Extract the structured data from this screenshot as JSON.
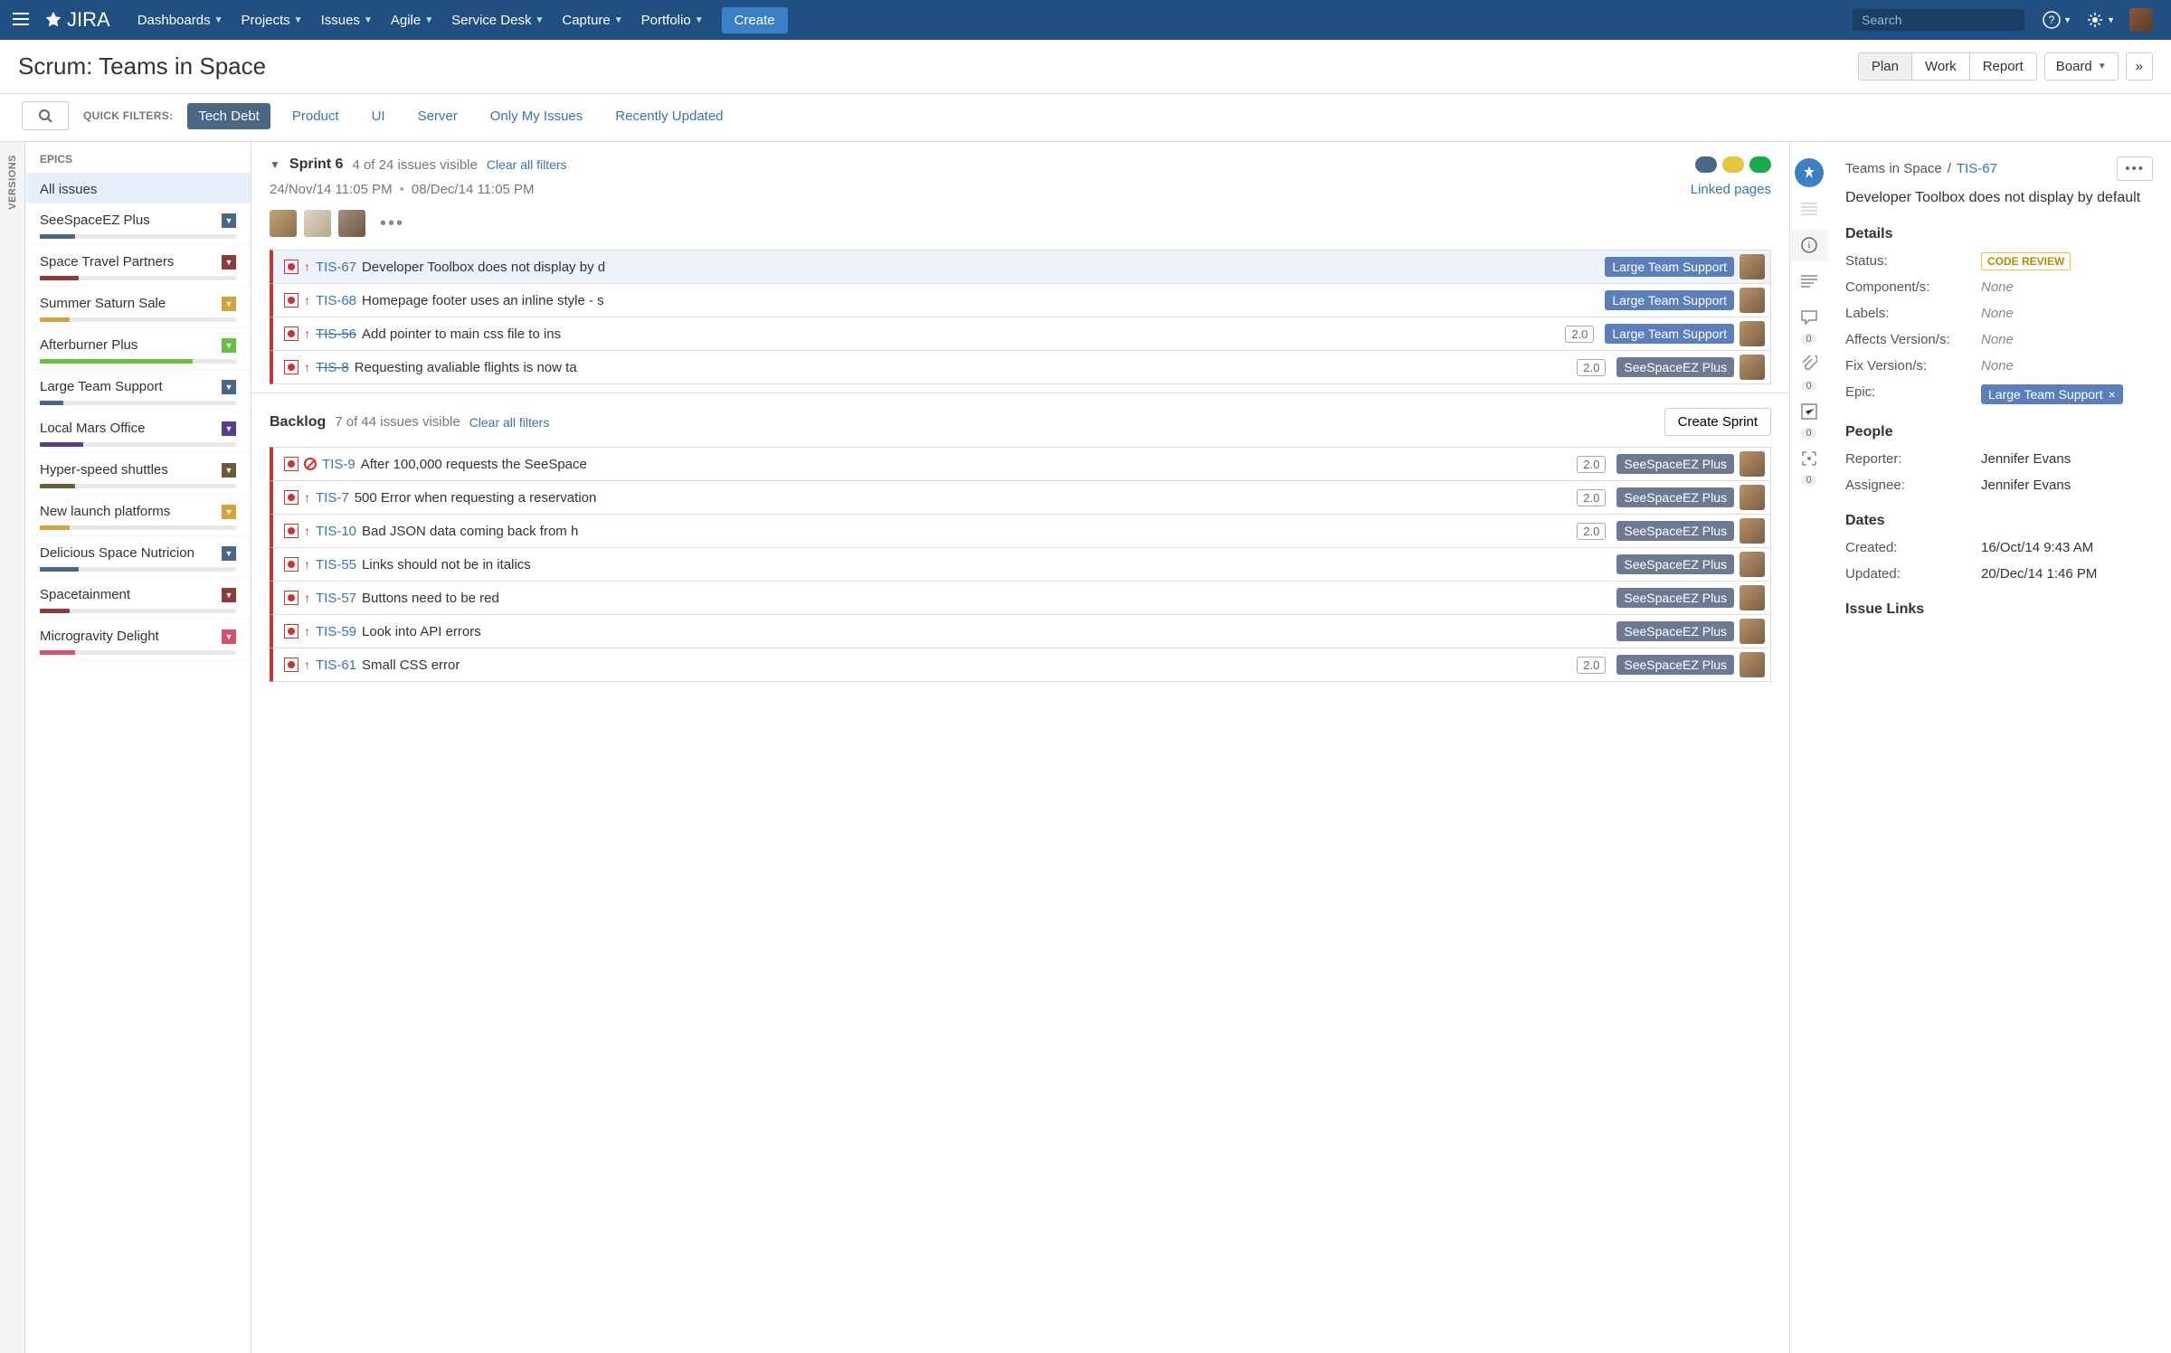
{
  "topnav": {
    "logo": "JIRA",
    "items": [
      "Dashboards",
      "Projects",
      "Issues",
      "Agile",
      "Service Desk",
      "Capture",
      "Portfolio"
    ],
    "create": "Create",
    "search_placeholder": "Search"
  },
  "header": {
    "title": "Scrum: Teams in Space",
    "views": [
      "Plan",
      "Work",
      "Report"
    ],
    "active_view": "Plan",
    "board_label": "Board"
  },
  "filters": {
    "label": "QUICK FILTERS:",
    "items": [
      "Tech Debt",
      "Product",
      "UI",
      "Server",
      "Only My Issues",
      "Recently Updated"
    ],
    "active": "Tech Debt"
  },
  "versions_label": "VERSIONS",
  "epics": {
    "header": "EPICS",
    "all_issues": "All issues",
    "items": [
      {
        "name": "SeeSpaceEZ Plus",
        "color": "#4a6785",
        "fill": 18
      },
      {
        "name": "Space Travel Partners",
        "color": "#8e3b3b",
        "fill": 20
      },
      {
        "name": "Summer Saturn Sale",
        "color": "#d6a23a",
        "fill": 15
      },
      {
        "name": "Afterburner Plus",
        "color": "#6abf40",
        "fill": 78
      },
      {
        "name": "Large Team Support",
        "color": "#4a6785",
        "fill": 12
      },
      {
        "name": "Local Mars Office",
        "color": "#5b3b8e",
        "fill": 22
      },
      {
        "name": "Hyper-speed shuttles",
        "color": "#6b5a3b",
        "fill": 18
      },
      {
        "name": "New launch platforms",
        "color": "#d6a23a",
        "fill": 15
      },
      {
        "name": "Delicious Space Nutricion",
        "color": "#4a6785",
        "fill": 20
      },
      {
        "name": "Spacetainment",
        "color": "#8e3b3b",
        "fill": 15
      },
      {
        "name": "Microgravity Delight",
        "color": "#d6506b",
        "fill": 18
      }
    ]
  },
  "sprint": {
    "name": "Sprint 6",
    "count_text": "4 of 24 issues visible",
    "clear": "Clear all filters",
    "date_start": "24/Nov/14 11:05 PM",
    "date_end": "08/Dec/14 11:05 PM",
    "linked": "Linked pages",
    "dot_colors": [
      "#4a6785",
      "#e4c641",
      "#1aab4e"
    ],
    "issues": [
      {
        "key": "TIS-67",
        "summary": "Developer Toolbox does not display by d",
        "epic": "Large Team Support",
        "epicClass": "blue",
        "selected": true
      },
      {
        "key": "TIS-68",
        "summary": "Homepage footer uses an inline style - s",
        "epic": "Large Team Support",
        "epicClass": "blue"
      },
      {
        "key": "TIS-56",
        "summary": "Add pointer to main css file to ins",
        "epic": "Large Team Support",
        "epicClass": "blue",
        "ver": "2.0",
        "strike": true
      },
      {
        "key": "TIS-8",
        "summary": "Requesting avaliable flights is now ta",
        "epic": "SeeSpaceEZ Plus",
        "epicClass": "slate",
        "ver": "2.0",
        "strike": true
      }
    ]
  },
  "backlog": {
    "name": "Backlog",
    "count_text": "7 of 44 issues visible",
    "clear": "Clear all filters",
    "create_sprint": "Create Sprint",
    "issues": [
      {
        "key": "TIS-9",
        "summary": "After 100,000 requests the SeeSpace",
        "epic": "SeeSpaceEZ Plus",
        "epicClass": "slate",
        "ver": "2.0",
        "blocker": true
      },
      {
        "key": "TIS-7",
        "summary": "500 Error when requesting a reservation",
        "epic": "SeeSpaceEZ Plus",
        "epicClass": "slate",
        "ver": "2.0"
      },
      {
        "key": "TIS-10",
        "summary": "Bad JSON data coming back from h",
        "epic": "SeeSpaceEZ Plus",
        "epicClass": "slate",
        "ver": "2.0"
      },
      {
        "key": "TIS-55",
        "summary": "Links should not be in italics",
        "epic": "SeeSpaceEZ Plus",
        "epicClass": "slate"
      },
      {
        "key": "TIS-57",
        "summary": "Buttons need to be red",
        "epic": "SeeSpaceEZ Plus",
        "epicClass": "slate"
      },
      {
        "key": "TIS-59",
        "summary": "Look into API errors",
        "epic": "SeeSpaceEZ Plus",
        "epicClass": "slate"
      },
      {
        "key": "TIS-61",
        "summary": "Small CSS error",
        "epic": "SeeSpaceEZ Plus",
        "epicClass": "slate",
        "ver": "2.0"
      }
    ]
  },
  "detail": {
    "project": "Teams in Space",
    "key": "TIS-67",
    "title": "Developer Toolbox does not display by default",
    "details_h": "Details",
    "status_label": "Status:",
    "status_value": "CODE REVIEW",
    "components_label": "Component/s:",
    "labels_label": "Labels:",
    "affects_label": "Affects Version/s:",
    "fix_label": "Fix Version/s:",
    "epic_label": "Epic:",
    "epic_value": "Large Team Support",
    "none": "None",
    "people_h": "People",
    "reporter_label": "Reporter:",
    "reporter_value": "Jennifer Evans",
    "assignee_label": "Assignee:",
    "assignee_value": "Jennifer Evans",
    "dates_h": "Dates",
    "created_label": "Created:",
    "created_value": "16/Oct/14 9:43 AM",
    "updated_label": "Updated:",
    "updated_value": "20/Dec/14 1:46 PM",
    "links_h": "Issue Links"
  }
}
